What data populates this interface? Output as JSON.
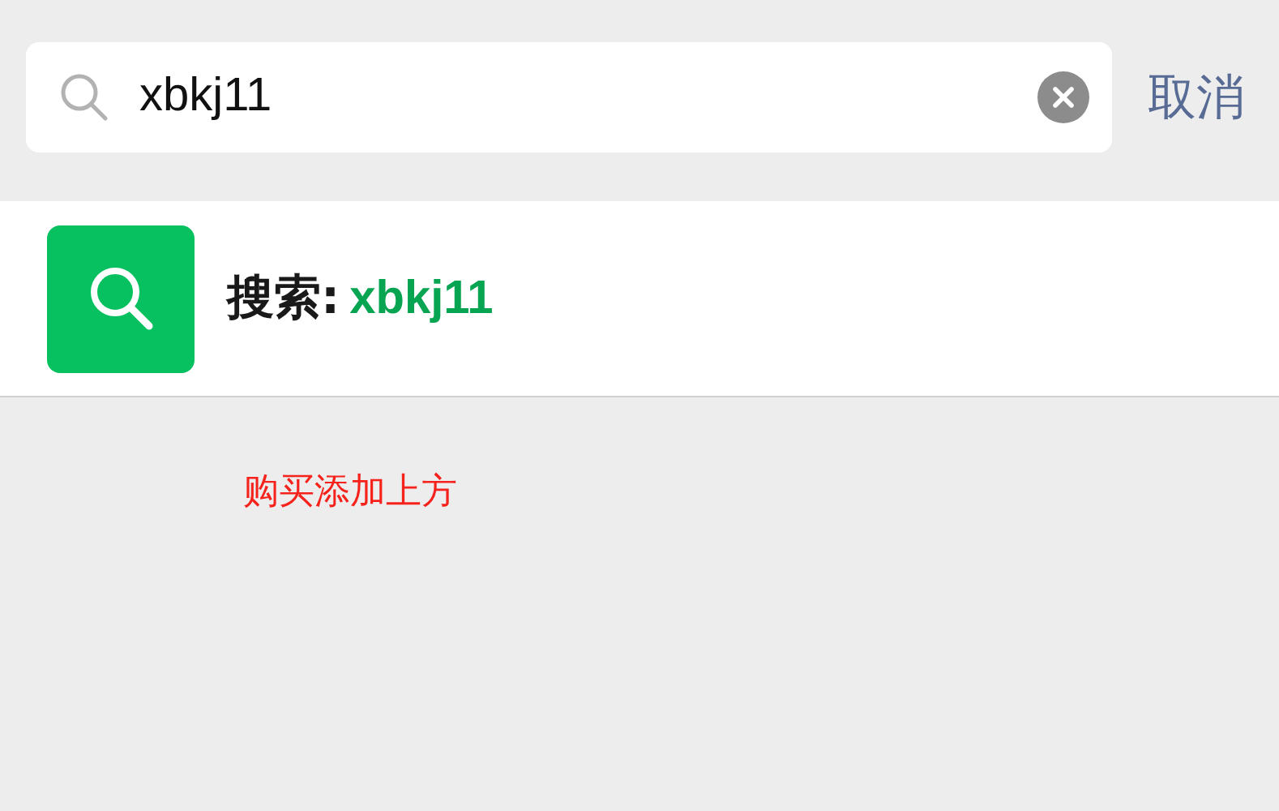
{
  "search": {
    "value": "xbkj11",
    "cancel": "取消"
  },
  "result": {
    "label": "搜索:",
    "query": "xbkj11"
  },
  "note": "购买添加上方"
}
